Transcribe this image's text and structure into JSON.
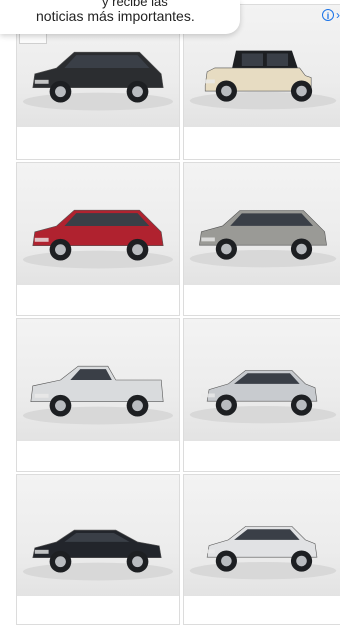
{
  "notice": {
    "line1_link": "",
    "line1_rest": "y recibe las",
    "line2": "noticias más importantes."
  },
  "ad_choices": {
    "info_icon": "info-icon",
    "close_icon": "close-icon"
  },
  "cars": [
    {
      "name": "black-suv",
      "color": "#2b2d30",
      "body": "suv"
    },
    {
      "name": "jeep",
      "color": "#e7dcc2",
      "body": "jeep"
    },
    {
      "name": "red-crossover",
      "color": "#b0222f",
      "body": "crossover"
    },
    {
      "name": "gray-suv",
      "color": "#9a9a96",
      "body": "suv"
    },
    {
      "name": "white-pickup",
      "color": "#d9dbdd",
      "body": "pickup"
    },
    {
      "name": "silver-hatchback",
      "color": "#c8cbcf",
      "body": "hatch"
    },
    {
      "name": "dark-sedan",
      "color": "#22252b",
      "body": "sedan"
    },
    {
      "name": "white-compact",
      "color": "#e1e2e4",
      "body": "compact"
    }
  ],
  "colors": {
    "card_border": "#dcdcdc",
    "link": "#1a73e8",
    "background": "#ffffff"
  }
}
